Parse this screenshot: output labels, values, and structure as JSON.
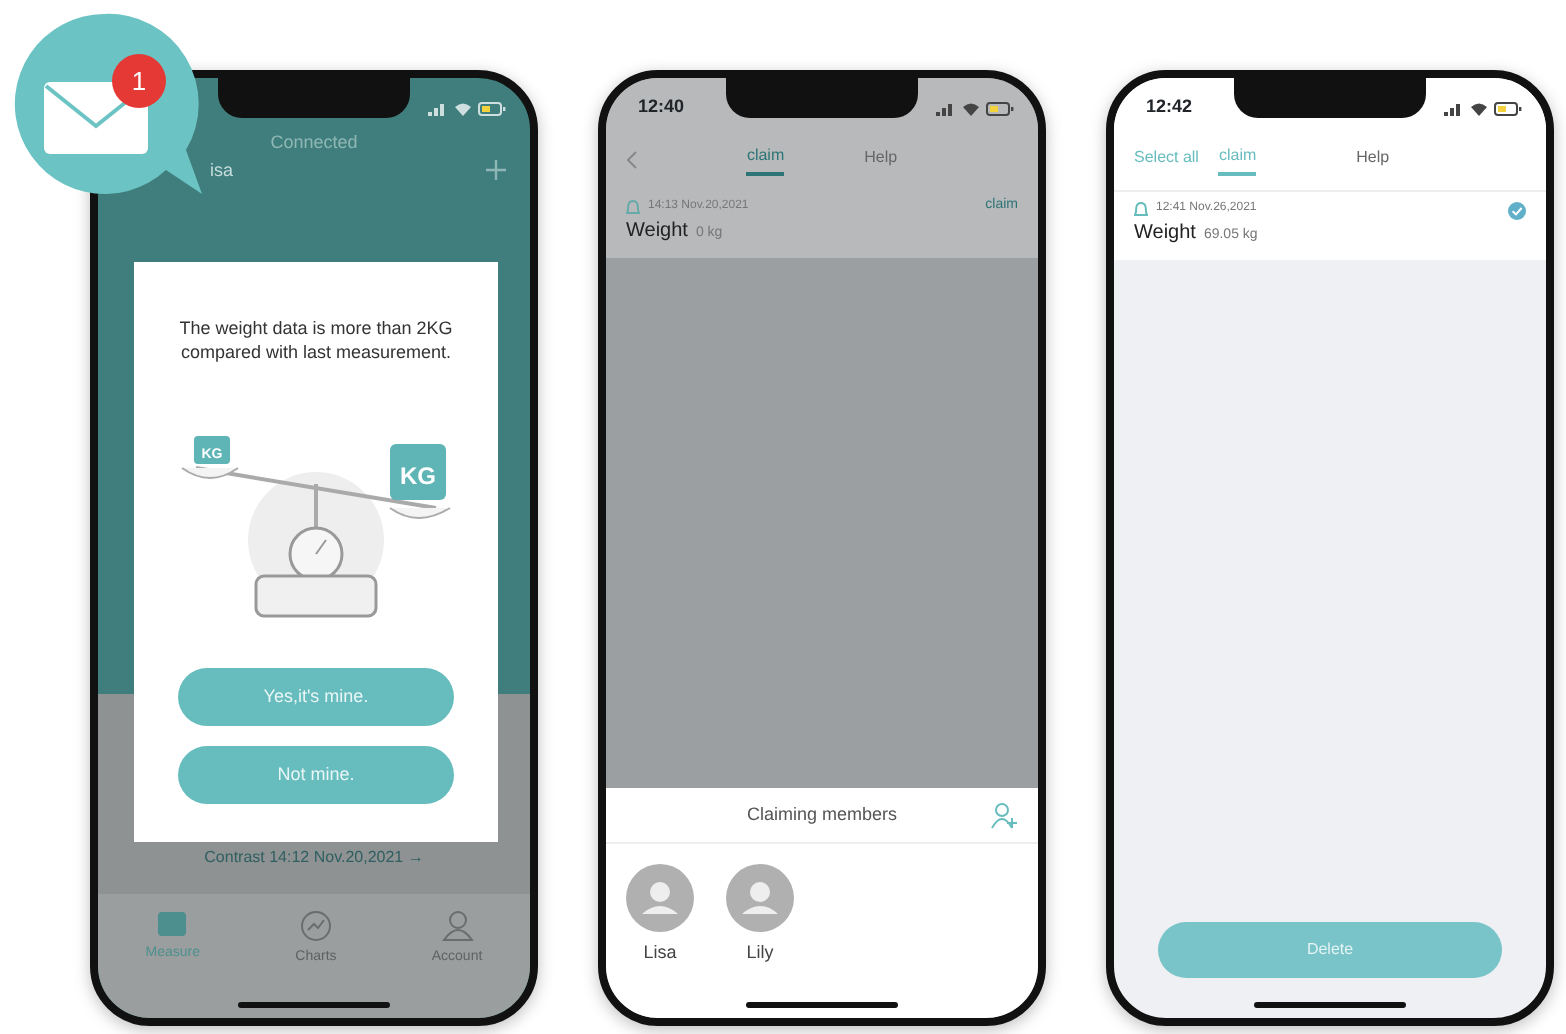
{
  "notification": {
    "count": "1"
  },
  "screen_1": {
    "header": {
      "title": "Connected",
      "user": "isa"
    },
    "dialog": {
      "message": "The weight data is more than 2KG compared with last measurement.",
      "weight_labels": [
        "KG",
        "KG"
      ],
      "buttons": [
        "Yes,it's mine.",
        "Not mine."
      ]
    },
    "contrast_link": "Contrast 14:12 Nov.20,2021 →",
    "tabs": [
      {
        "label": "Measure",
        "selected": true
      },
      {
        "label": "Charts",
        "selected": false
      },
      {
        "label": "Account",
        "selected": false
      }
    ]
  },
  "screen_2": {
    "time": "12:40",
    "tabs": [
      {
        "label": "claim",
        "selected": true
      },
      {
        "label": "Help",
        "selected": false
      }
    ],
    "record": {
      "date": "14:13 Nov.20,2021",
      "action": "claim",
      "label": "Weight",
      "value": "0 kg"
    },
    "sheet": {
      "title": "Claiming members",
      "members": [
        {
          "name": "Lisa"
        },
        {
          "name": "Lily"
        }
      ]
    }
  },
  "screen_3": {
    "time": "12:42",
    "select_all": "Select all",
    "tabs": [
      {
        "label": "claim",
        "selected": true
      },
      {
        "label": "Help",
        "selected": false
      }
    ],
    "record": {
      "date": "12:41 Nov.26,2021",
      "label": "Weight",
      "value": "69.05 kg",
      "checked": true
    },
    "delete_button": "Delete"
  }
}
